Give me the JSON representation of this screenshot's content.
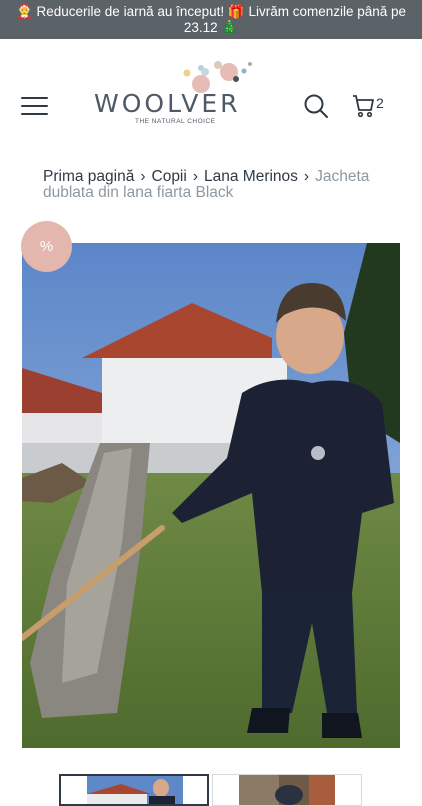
{
  "announcement": {
    "text": "🤶 Reducerile de iarnă au început! 🎁 Livrăm comenzile până pe 23.12 🎄"
  },
  "header": {
    "logo": {
      "word": "WOOLVER",
      "tagline": "THE NATURAL CHOICE"
    },
    "cart_count": "2"
  },
  "breadcrumb": {
    "items": [
      "Prima pagină",
      "Copii",
      "Lana Merinos"
    ],
    "current": "Jacheta dublata din lana fiarta Black"
  },
  "product": {
    "badge": "%"
  },
  "colors": {
    "announce_bg": "#5b6268",
    "badge": "#e3b7ae",
    "text": "#2f3a45",
    "muted": "#8d989f"
  },
  "icons": [
    "menu-icon",
    "search-icon",
    "cart-icon"
  ]
}
